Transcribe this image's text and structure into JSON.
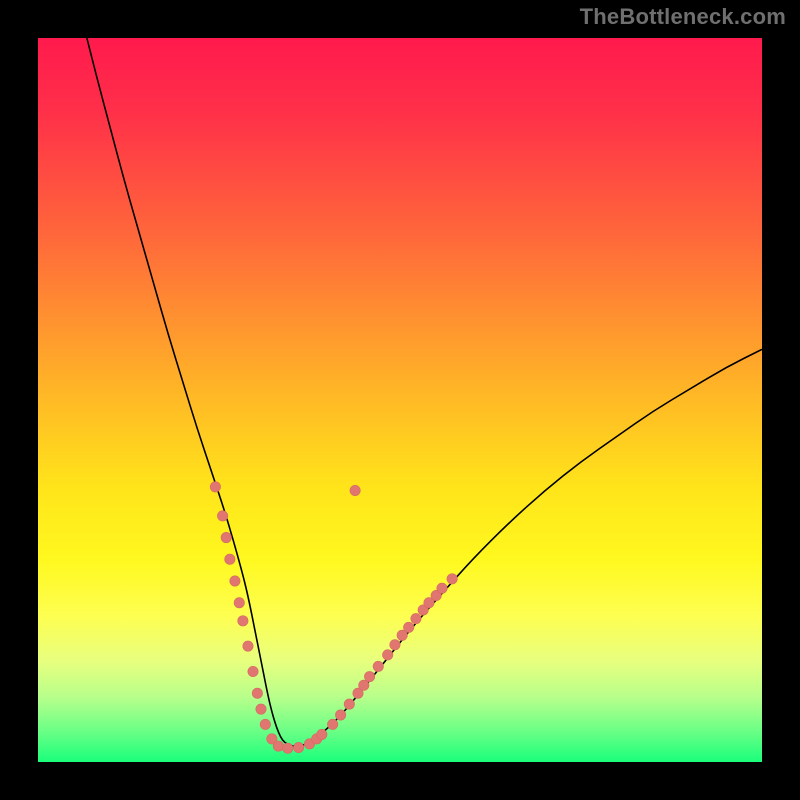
{
  "watermark": "TheBottleneck.com",
  "colors": {
    "black": "#000000",
    "curve": "#000000",
    "marker_fill": "#e0766f",
    "marker_stroke": "#d66a64",
    "gradient_stops": [
      {
        "offset": 0.0,
        "color": "#ff1a4d"
      },
      {
        "offset": 0.1,
        "color": "#ff2f49"
      },
      {
        "offset": 0.28,
        "color": "#ff6a3a"
      },
      {
        "offset": 0.48,
        "color": "#ffb327"
      },
      {
        "offset": 0.62,
        "color": "#ffe41a"
      },
      {
        "offset": 0.72,
        "color": "#fff81f"
      },
      {
        "offset": 0.8,
        "color": "#fdff52"
      },
      {
        "offset": 0.86,
        "color": "#e8ff7e"
      },
      {
        "offset": 0.91,
        "color": "#b8ff8b"
      },
      {
        "offset": 0.955,
        "color": "#6eff86"
      },
      {
        "offset": 1.0,
        "color": "#1bff7b"
      }
    ]
  },
  "chart_data": {
    "type": "line",
    "title": "",
    "xlabel": "",
    "ylabel": "",
    "xlim": [
      0,
      100
    ],
    "ylim": [
      0,
      100
    ],
    "grid": false,
    "series": [
      {
        "name": "bottleneck-curve",
        "x": [
          6,
          8,
          10,
          12,
          14,
          16,
          18,
          20,
          22,
          24,
          26,
          28,
          29,
          30,
          31,
          32,
          33,
          34,
          36,
          38,
          41,
          44,
          48,
          52,
          56,
          60,
          65,
          70,
          75,
          80,
          85,
          90,
          95,
          100
        ],
        "values": [
          103,
          95,
          87.5,
          80,
          73,
          66,
          59,
          52.5,
          46,
          40,
          34,
          27,
          23,
          18,
          13,
          8,
          4.5,
          2.5,
          2,
          3,
          5.5,
          9,
          14,
          19,
          23.5,
          28,
          33,
          37.5,
          41.5,
          45,
          48.5,
          51.5,
          54.5,
          57
        ]
      }
    ],
    "markers": [
      {
        "x": 24.5,
        "y": 38
      },
      {
        "x": 25.5,
        "y": 34
      },
      {
        "x": 26.0,
        "y": 31
      },
      {
        "x": 26.5,
        "y": 28
      },
      {
        "x": 27.2,
        "y": 25
      },
      {
        "x": 27.8,
        "y": 22
      },
      {
        "x": 28.3,
        "y": 19.5
      },
      {
        "x": 29.0,
        "y": 16
      },
      {
        "x": 29.7,
        "y": 12.5
      },
      {
        "x": 30.3,
        "y": 9.5
      },
      {
        "x": 30.8,
        "y": 7.3
      },
      {
        "x": 31.4,
        "y": 5.2
      },
      {
        "x": 32.3,
        "y": 3.2
      },
      {
        "x": 33.2,
        "y": 2.2
      },
      {
        "x": 34.5,
        "y": 1.9
      },
      {
        "x": 36.0,
        "y": 2.0
      },
      {
        "x": 37.5,
        "y": 2.5
      },
      {
        "x": 38.5,
        "y": 3.2
      },
      {
        "x": 39.2,
        "y": 3.8
      },
      {
        "x": 40.7,
        "y": 5.2
      },
      {
        "x": 41.8,
        "y": 6.5
      },
      {
        "x": 43.0,
        "y": 8.0
      },
      {
        "x": 44.2,
        "y": 9.5
      },
      {
        "x": 45.0,
        "y": 10.6
      },
      {
        "x": 45.8,
        "y": 11.8
      },
      {
        "x": 47.0,
        "y": 13.2
      },
      {
        "x": 48.3,
        "y": 14.8
      },
      {
        "x": 49.3,
        "y": 16.2
      },
      {
        "x": 50.3,
        "y": 17.5
      },
      {
        "x": 51.2,
        "y": 18.6
      },
      {
        "x": 52.2,
        "y": 19.8
      },
      {
        "x": 53.2,
        "y": 21.0
      },
      {
        "x": 54.0,
        "y": 22.0
      },
      {
        "x": 55.0,
        "y": 23.0
      },
      {
        "x": 55.8,
        "y": 24.0
      },
      {
        "x": 57.2,
        "y": 25.3
      },
      {
        "x": 43.8,
        "y": 37.5
      }
    ]
  }
}
